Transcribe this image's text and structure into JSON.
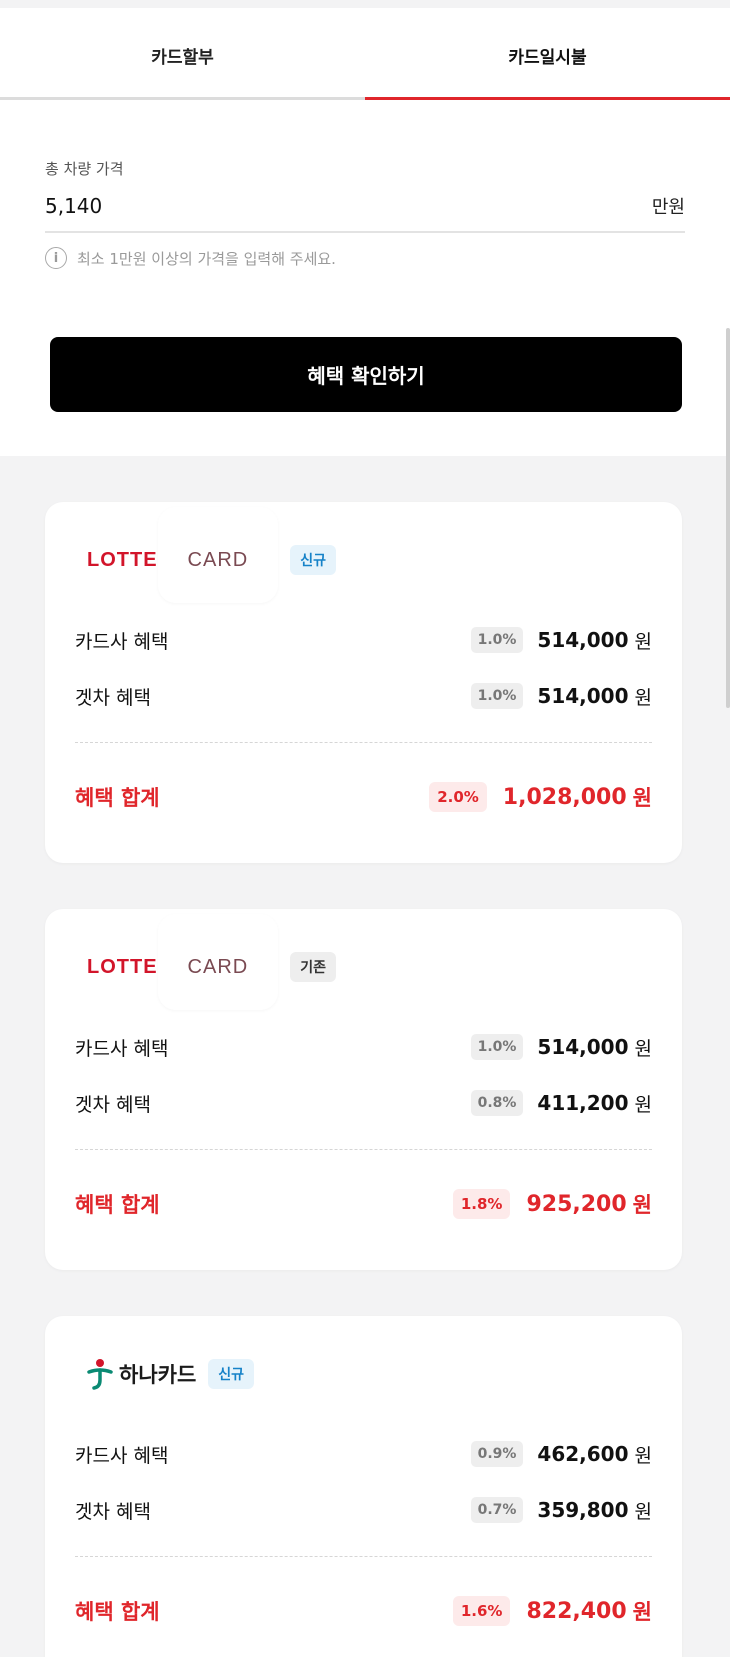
{
  "tabs": [
    {
      "label": "카드할부",
      "active": false
    },
    {
      "label": "카드일시불",
      "active": true
    }
  ],
  "price": {
    "label": "총 차량 가격",
    "value": "5,140",
    "unit": "만원",
    "hint": "최소 1만원 이상의 가격을 입력해 주세요."
  },
  "confirm_button": "혜택 확인하기",
  "colors": {
    "accent": "#e0262b",
    "button_bg": "#000000",
    "new_badge": "#1682c8"
  },
  "cards": [
    {
      "logo": {
        "type": "lotte",
        "text1": "LOTTE",
        "text2": "CARD"
      },
      "badge": {
        "label": "신규",
        "kind": "new"
      },
      "rows": [
        {
          "label": "카드사 혜택",
          "rate": "1.0%",
          "amount": "514,000",
          "unit": "원"
        },
        {
          "label": "겟차 혜택",
          "rate": "1.0%",
          "amount": "514,000",
          "unit": "원"
        }
      ],
      "total": {
        "label": "혜택 합계",
        "rate": "2.0%",
        "amount": "1,028,000",
        "unit": "원"
      }
    },
    {
      "logo": {
        "type": "lotte",
        "text1": "LOTTE",
        "text2": "CARD"
      },
      "badge": {
        "label": "기존",
        "kind": "old"
      },
      "rows": [
        {
          "label": "카드사 혜택",
          "rate": "1.0%",
          "amount": "514,000",
          "unit": "원"
        },
        {
          "label": "겟차 혜택",
          "rate": "0.8%",
          "amount": "411,200",
          "unit": "원"
        }
      ],
      "total": {
        "label": "혜택 합계",
        "rate": "1.8%",
        "amount": "925,200",
        "unit": "원"
      }
    },
    {
      "logo": {
        "type": "hana",
        "text": "하나카드"
      },
      "badge": {
        "label": "신규",
        "kind": "new"
      },
      "rows": [
        {
          "label": "카드사 혜택",
          "rate": "0.9%",
          "amount": "462,600",
          "unit": "원"
        },
        {
          "label": "겟차 혜택",
          "rate": "0.7%",
          "amount": "359,800",
          "unit": "원"
        }
      ],
      "total": {
        "label": "혜택 합계",
        "rate": "1.6%",
        "amount": "822,400",
        "unit": "원"
      }
    }
  ]
}
